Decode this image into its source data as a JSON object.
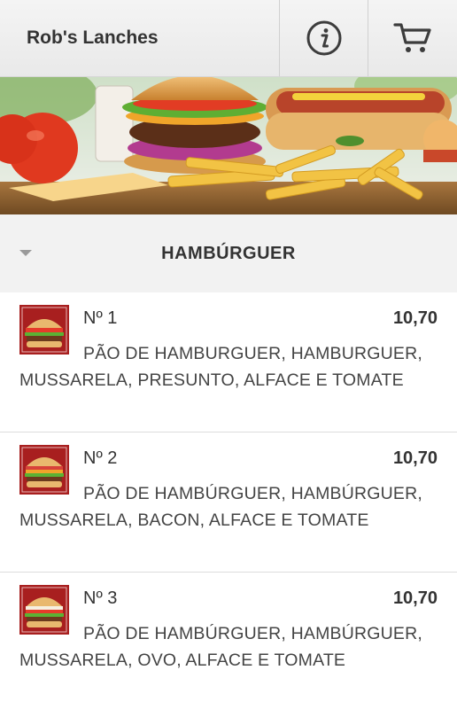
{
  "header": {
    "title": "Rob's Lanches",
    "info_icon": "info-icon",
    "cart_icon": "cart-icon"
  },
  "category": {
    "label": "HAMBÚRGUER",
    "arrow_icon": "caret-down-icon"
  },
  "items": [
    {
      "name": "Nº 1",
      "price": "10,70",
      "description": "PÃO DE HAMBURGUER, HAMBURGUER, MUSSARELA, PRESUNTO, ALFACE E TOMATE"
    },
    {
      "name": "Nº 2",
      "price": "10,70",
      "description": "PÃO DE HAMBÚRGUER, HAMBÚRGUER, MUSSARELA, BACON, ALFACE E TOMATE"
    },
    {
      "name": "Nº 3",
      "price": "10,70",
      "description": "PÃO DE HAMBÚRGUER, HAMBÚRGUER, MUSSARELA, OVO, ALFACE E TOMATE"
    }
  ],
  "colors": {
    "header_bg": "#ececec",
    "category_bg": "#f2f2f2",
    "text": "#333333",
    "divider": "#dcdcdc"
  }
}
